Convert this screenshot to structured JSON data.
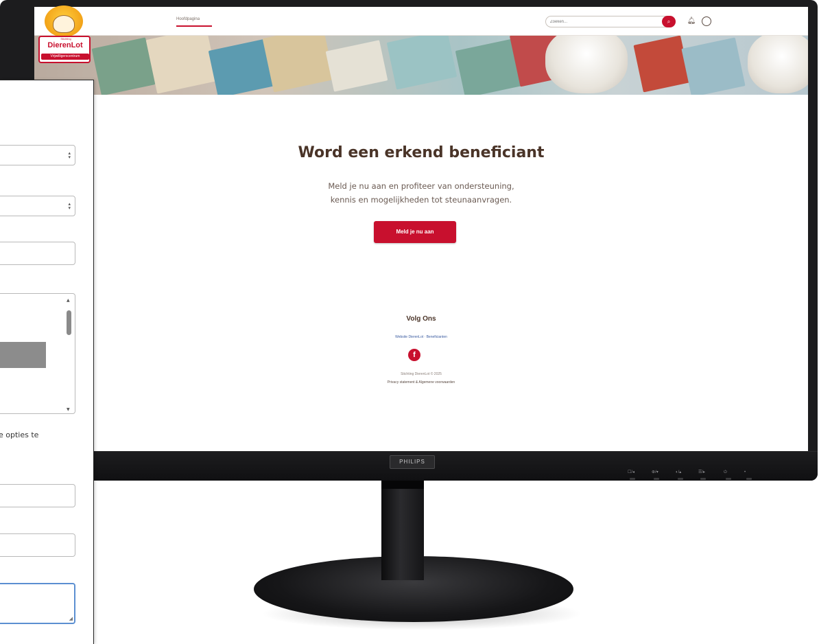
{
  "monitor": {
    "brand": "PHILIPS",
    "controls": [
      "☐/◂",
      "⊕/▾",
      "◐/▴",
      "☰/▸",
      "⏻",
      "•"
    ]
  },
  "site": {
    "logo": {
      "top_text": "Stichting",
      "name": "DierenLot",
      "sub_text": "Vrijwilligerscentrum"
    },
    "nav": {
      "home_label": "Hoofdpagina"
    },
    "search": {
      "placeholder": "Zoeken...",
      "icon": "search-icon"
    },
    "header_icons": [
      "bell-icon",
      "user-icon"
    ],
    "hero_images": [
      "poster-cards",
      "white-dog"
    ],
    "main": {
      "title": "Word een erkend beneficiant",
      "subtitle_line1": "Meld je nu aan en profiteer van ondersteuning,",
      "subtitle_line2": "kennis en mogelijkheden tot steunaanvragen.",
      "cta_label": "Meld je nu aan"
    },
    "footer": {
      "follow_title": "Volg Ons",
      "links": "Website DierenLot · Beneficianten",
      "copyright": "Stichting DierenLot © 2025",
      "legal": "Privacy statement & Algemene voorwaarden"
    }
  },
  "form_panel": {
    "hint_text": "e opties te",
    "colors": {
      "focus": "#5b8fd1",
      "selected": "#8c8c8c"
    }
  },
  "colors": {
    "accent": "#c8102e",
    "heading": "#4a3428",
    "bezel": "#1c1c1e"
  }
}
